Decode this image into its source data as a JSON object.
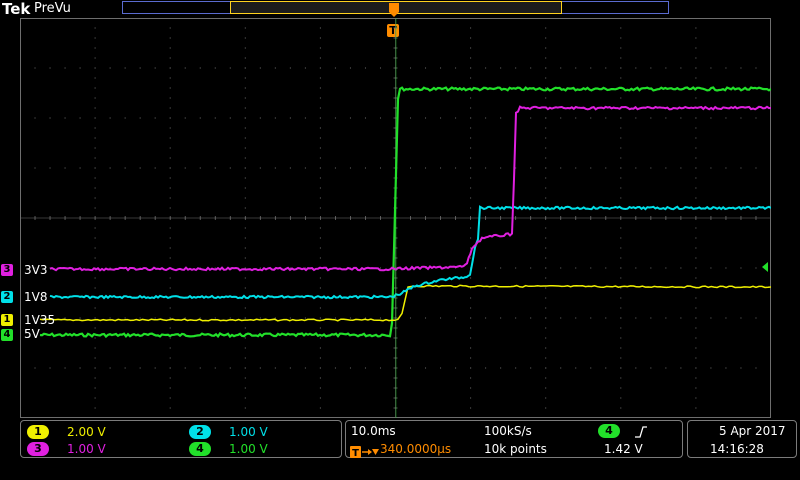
{
  "topbar": {
    "logo": "Tek",
    "mode": "PreVu"
  },
  "trigger": {
    "position_label": "T",
    "marker": "T"
  },
  "colors": {
    "ch1": "#f0f000",
    "ch2": "#00e0e8",
    "ch3": "#e020e0",
    "ch4": "#22e02a",
    "trigger": "#ff8c00",
    "grid": "#6e6e6e"
  },
  "channels": [
    {
      "num": "3",
      "label": "3V3"
    },
    {
      "num": "2",
      "label": "1V8"
    },
    {
      "num": "1",
      "label": "1V35"
    },
    {
      "num": "4",
      "label": "5V"
    }
  ],
  "scale_panel": {
    "ch1": {
      "num": "1",
      "value": "2.00 V"
    },
    "ch2": {
      "num": "2",
      "value": "1.00 V"
    },
    "ch3": {
      "num": "3",
      "value": "1.00 V"
    },
    "ch4": {
      "num": "4",
      "value": "1.00 V"
    }
  },
  "timebase": {
    "time_div": "10.0ms",
    "sample_rate": "100kS/s",
    "trigger_delay": "340.0000µs",
    "record_length": "10k points"
  },
  "trigger_panel": {
    "source": "4",
    "slope_icon": "rising-edge-icon",
    "level": "1.42 V"
  },
  "datetime": {
    "date": "5 Apr 2017",
    "time": "14:16:28"
  }
}
